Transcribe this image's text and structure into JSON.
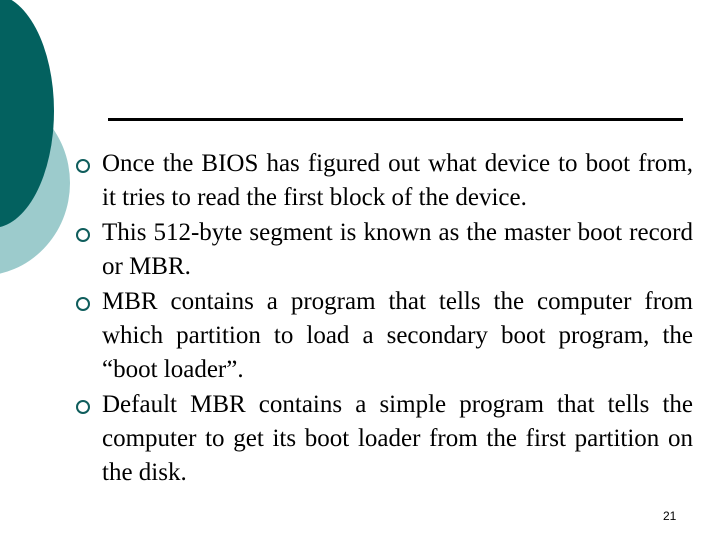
{
  "slide": {
    "bullets": [
      {
        "text": "Once the BIOS has figured out what device to boot from, it tries to read the first block of the device."
      },
      {
        "text": "This 512-byte segment is known as the master boot record or MBR."
      },
      {
        "text": "MBR contains a program that tells the computer from which partition to load a secondary boot program, the “boot loader”."
      },
      {
        "text": "Default MBR contains a simple program that tells the computer to get its boot loader from the first partition on the disk."
      }
    ],
    "page_number": "21",
    "bullet_icon": "hollow-circle-icon",
    "colors": {
      "accent_dark": "#03615f",
      "accent_light": "#9ccbcc",
      "bullet": "#0f5d5c"
    }
  }
}
